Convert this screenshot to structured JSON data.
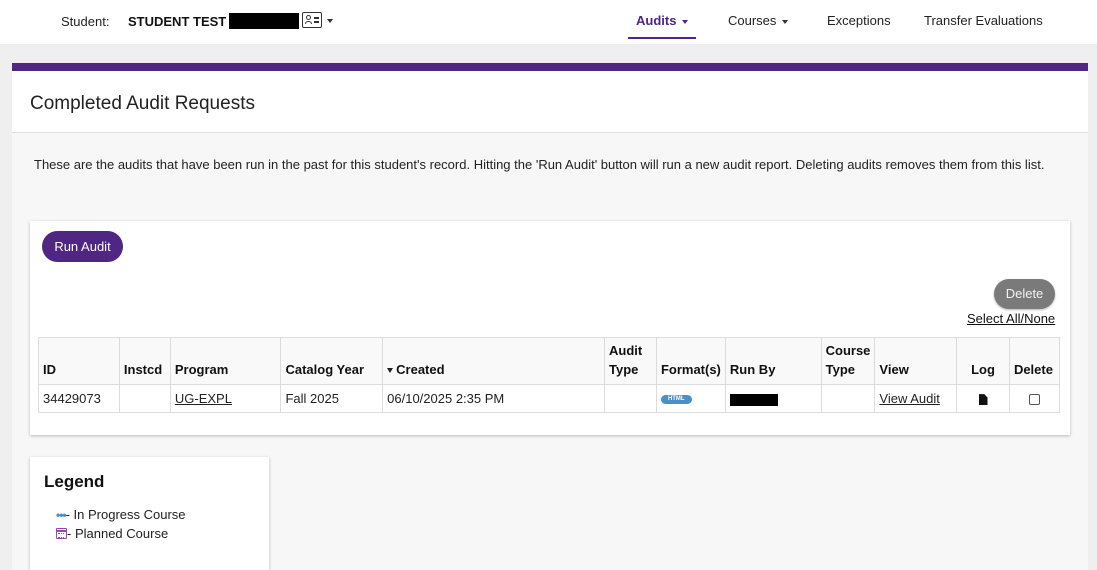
{
  "header": {
    "student_label": "Student:",
    "student_name": "STUDENT TEST /",
    "nav": {
      "audits": "Audits",
      "courses": "Courses",
      "exceptions": "Exceptions",
      "transfer": "Transfer Evaluations"
    }
  },
  "page": {
    "title": "Completed Audit Requests",
    "description": "These are the audits that have been run in the past for this student's record. Hitting the 'Run Audit' button will run a new audit report. Deleting audits removes them from this list."
  },
  "actions": {
    "run_audit": "Run Audit",
    "delete": "Delete",
    "select_all": "Select All/None"
  },
  "table": {
    "headers": {
      "id": "ID",
      "instcd": "Instcd",
      "program": "Program",
      "catalog_year": "Catalog Year",
      "created": "Created",
      "audit_type": "Audit Type",
      "formats": "Format(s)",
      "run_by": "Run By",
      "course_type": "Course Type",
      "view": "View",
      "log": "Log",
      "delete": "Delete"
    },
    "rows": [
      {
        "id": "34429073",
        "instcd": "",
        "program": "UG-EXPL",
        "catalog_year": "Fall 2025",
        "created": "06/10/2025 2:35 PM",
        "audit_type": "",
        "format": "HTML",
        "course_type": "",
        "view": "View Audit"
      }
    ]
  },
  "legend": {
    "title": "Legend",
    "in_progress": "- In Progress Course",
    "planned": "- Planned Course"
  },
  "colors": {
    "accent": "#4f2683",
    "badge": "#4a90c8"
  }
}
